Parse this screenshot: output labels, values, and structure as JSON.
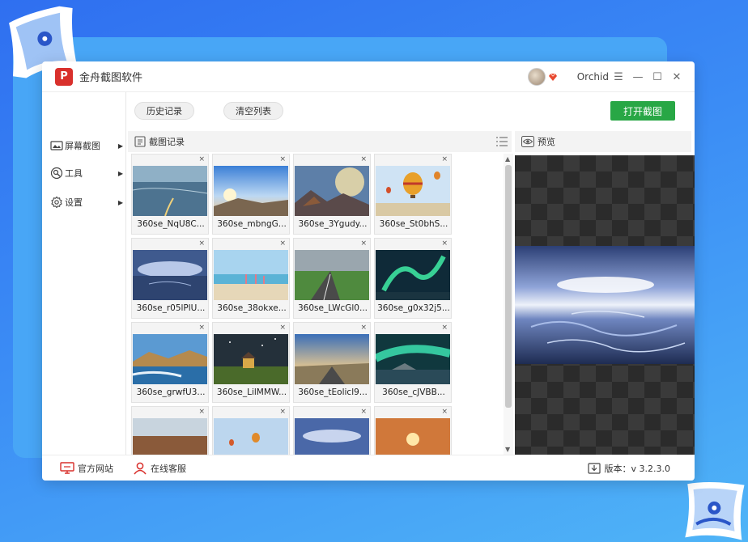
{
  "app": {
    "title": "金舟截图软件",
    "logo_text": "P"
  },
  "user": {
    "name": "Orchid"
  },
  "window_controls": [
    "menu-icon",
    "minimize-icon",
    "maximize-icon",
    "close-icon"
  ],
  "sidebar": {
    "items": [
      {
        "label": "屏幕截图",
        "icon": "screenshot-icon"
      },
      {
        "label": "工具",
        "icon": "tools-icon"
      },
      {
        "label": "设置",
        "icon": "settings-icon"
      }
    ]
  },
  "toolbar": {
    "history_label": "历史记录",
    "clear_label": "清空列表",
    "open_label": "打开截图"
  },
  "list": {
    "header": "截图记录",
    "items": [
      {
        "name": "360se_NqU8C..."
      },
      {
        "name": "360se_mbngG..."
      },
      {
        "name": "360se_3Ygudy..."
      },
      {
        "name": "360se_St0bhS..."
      },
      {
        "name": "360se_r05lPlU..."
      },
      {
        "name": "360se_38okxe..."
      },
      {
        "name": "360se_LWcGl0..."
      },
      {
        "name": "360se_g0x32j5..."
      },
      {
        "name": "360se_grwfU3..."
      },
      {
        "name": "360se_LilMMW..."
      },
      {
        "name": "360se_tEolicl9..."
      },
      {
        "name": "360se_cJVBB..."
      },
      {
        "name": ""
      },
      {
        "name": ""
      },
      {
        "name": ""
      },
      {
        "name": ""
      }
    ],
    "close_glyph": "×"
  },
  "preview": {
    "header": "预览"
  },
  "status": {
    "site_label": "官方网站",
    "service_label": "在线客服",
    "version_label": "版本：v 3.2.3.0"
  },
  "colors": {
    "accent_green": "#28a745",
    "brand_red": "#d9302c",
    "background_blue": "#3b8cf5"
  }
}
